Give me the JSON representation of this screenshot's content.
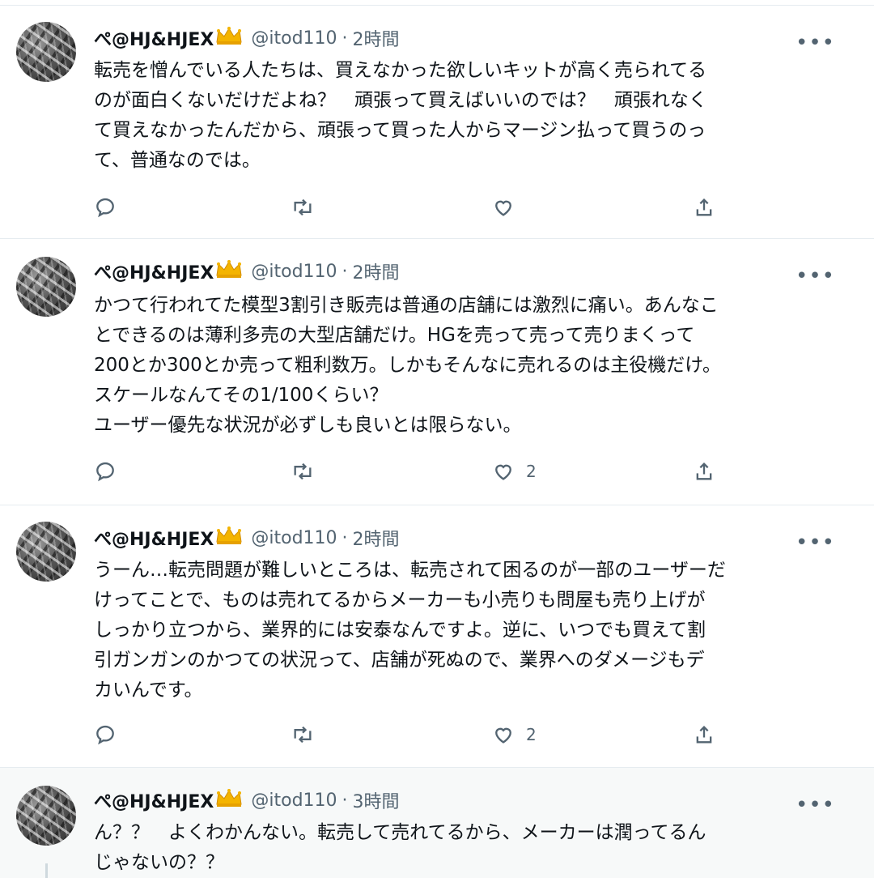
{
  "tweets": [
    {
      "name": "ぺ@HJ&HJEX",
      "handle": "@itod110",
      "sep": "·",
      "time": "2時間",
      "more": "•••",
      "text": "転売を憎んでいる人たちは、買えなかった欲しいキットが高く売られてる\nのが面白くないだけだよね？　頑張って買えばいいのでは？　頑張れなく\nて買えなかったんだから、頑張って買った人からマージン払って買うのっ\nて、普通なのでは。",
      "reply_count": "",
      "retweet_count": "",
      "like_count": ""
    },
    {
      "name": "ぺ@HJ&HJEX",
      "handle": "@itod110",
      "sep": "·",
      "time": "2時間",
      "more": "•••",
      "text": "かつて行われてた模型3割引き販売は普通の店舗には激烈に痛い。あんなこ\nとできるのは薄利多売の大型店舗だけ。HGを売って売って売りまくって\n200とか300とか売って粗利数万。しかもそんなに売れるのは主役機だけ。\nスケールなんてその1/100くらい？\nユーザー優先な状況が必ずしも良いとは限らない。",
      "reply_count": "",
      "retweet_count": "",
      "like_count": "2"
    },
    {
      "name": "ぺ@HJ&HJEX",
      "handle": "@itod110",
      "sep": "·",
      "time": "2時間",
      "more": "•••",
      "text": "うーん…転売問題が難しいところは、転売されて困るのが一部のユーザーだ\nけってことで、ものは売れてるからメーカーも小売りも問屋も売り上げが\nしっかり立つから、業界的には安泰なんですよ。逆に、いつでも買えて割\n引ガンガンのかつての状況って、店舗が死ぬので、業界へのダメージもデ\nカいんです。",
      "reply_count": "",
      "retweet_count": "",
      "like_count": "2"
    },
    {
      "name": "ぺ@HJ&HJEX",
      "handle": "@itod110",
      "sep": "·",
      "time": "3時間",
      "more": "•••",
      "text": "ん？？　よくわかんない。転売して売れてるから、メーカーは潤ってるん\nじゃないの？？"
    }
  ],
  "icons": {
    "avatar": "profile-avatar",
    "badge": "crown-emoji",
    "reply": "reply-icon",
    "retweet": "retweet-icon",
    "like": "heart-icon",
    "share": "share-icon",
    "more": "more-icon"
  },
  "colors": {
    "text": "#0f1419",
    "secondary": "#536471",
    "divider": "#e6ecf0",
    "highlight_bg": "#f7f9f9",
    "crown": "#f4b400"
  }
}
